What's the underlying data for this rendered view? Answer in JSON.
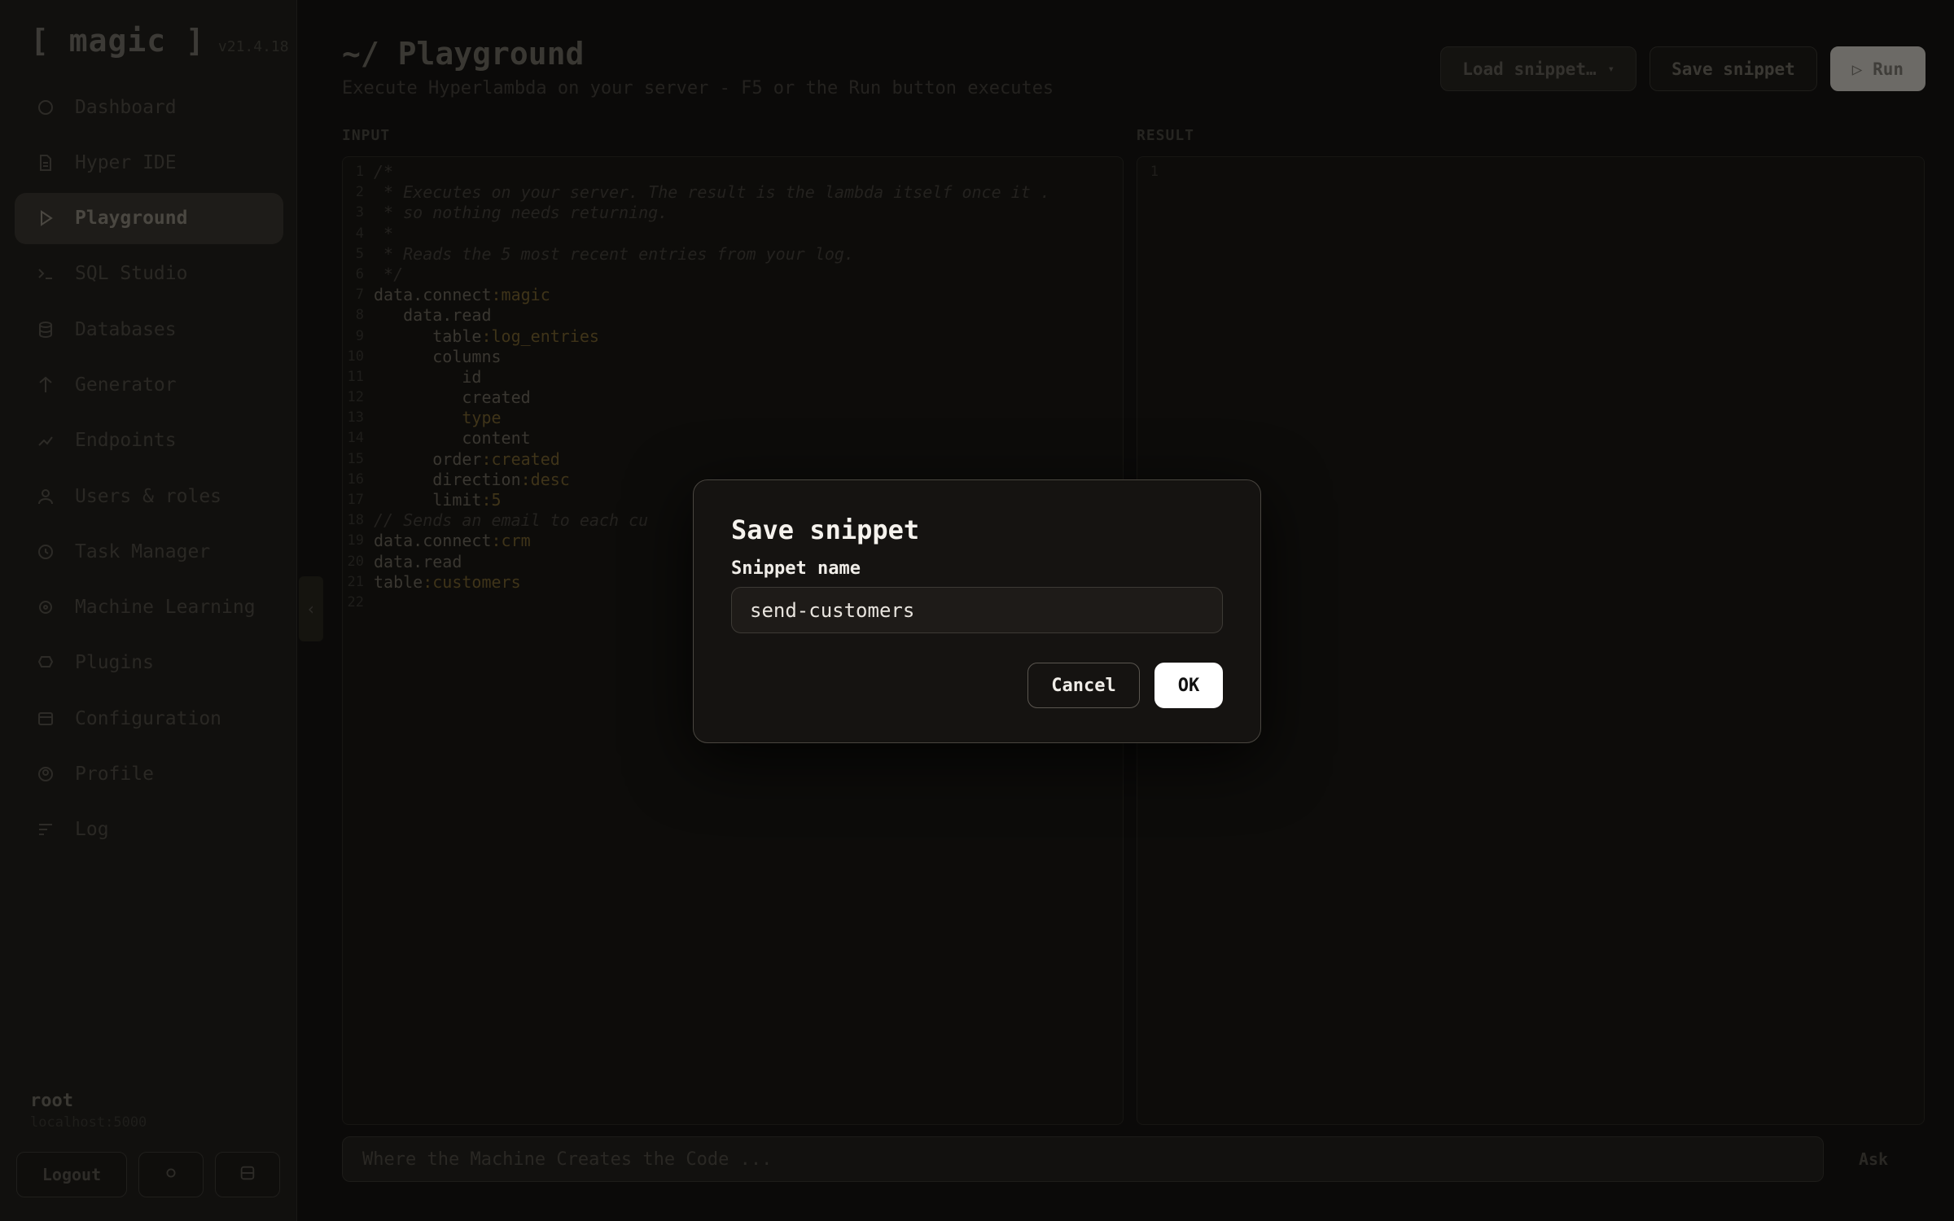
{
  "app": {
    "name": "[ magic ]",
    "version": "v21.4.18"
  },
  "sidebar": {
    "items": [
      {
        "label": "Dashboard",
        "icon": "dashboard-icon"
      },
      {
        "label": "Hyper IDE",
        "icon": "file-icon"
      },
      {
        "label": "Playground",
        "icon": "play-icon",
        "active": true
      },
      {
        "label": "SQL Studio",
        "icon": "terminal-icon"
      },
      {
        "label": "Databases",
        "icon": "database-icon"
      },
      {
        "label": "Generator",
        "icon": "generator-icon"
      },
      {
        "label": "Endpoints",
        "icon": "endpoints-icon"
      },
      {
        "label": "Users & roles",
        "icon": "user-icon"
      },
      {
        "label": "Task Manager",
        "icon": "clock-icon"
      },
      {
        "label": "Machine Learning",
        "icon": "ml-icon"
      },
      {
        "label": "Plugins",
        "icon": "plugin-icon"
      },
      {
        "label": "Configuration",
        "icon": "config-icon"
      },
      {
        "label": "Profile",
        "icon": "profile-icon"
      },
      {
        "label": "Log",
        "icon": "log-icon"
      }
    ],
    "collapse_glyph": "‹",
    "user": {
      "name": "root",
      "host": "localhost:5000"
    },
    "logout_label": "Logout"
  },
  "header": {
    "title": "~/ Playground",
    "subtitle": "Execute Hyperlambda on your server - F5 or the Run button executes",
    "load_snippet_label": "Load snippet…",
    "save_snippet_label": "Save snippet",
    "run_label": "▷ Run"
  },
  "panes": {
    "input_label": "INPUT",
    "result_label": "RESULT",
    "input_lines": [
      "/*",
      " * Executes on your server. The result is the lambda itself once it .",
      " * so nothing needs returning.",
      " *",
      " * Reads the 5 most recent entries from your log.",
      " */",
      "data.connect:magic",
      "   data.read",
      "      table:log_entries",
      "      columns",
      "         id",
      "         created",
      "         type",
      "         content",
      "      order:created",
      "      direction:desc",
      "      limit:5",
      "// Sends an email to each cu",
      "data.connect:crm",
      "data.read",
      "table:customers",
      ""
    ],
    "result_lines": [
      ""
    ]
  },
  "ask": {
    "placeholder": "Where the Machine Creates the Code ...",
    "button_label": "Ask"
  },
  "modal": {
    "title": "Save snippet",
    "field_label": "Snippet name",
    "field_value": "send-customers",
    "cancel_label": "Cancel",
    "ok_label": "OK"
  },
  "colors": {
    "accent": "#ffffff",
    "background": "#0b0a09",
    "modal_bg": "#151311",
    "keyword_value": "#8a6d2c"
  }
}
